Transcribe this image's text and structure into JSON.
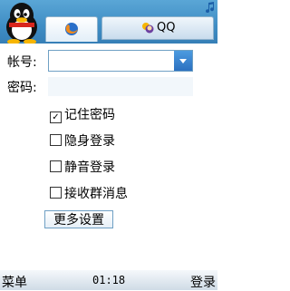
{
  "header": {
    "tab_left_icon": "firefox-like-globe-icon",
    "tab_right_label": "QQ",
    "tab_right_icon": "qq-buddy-icon",
    "status_icon": "music-note-icon"
  },
  "form": {
    "account_label": "帐号:",
    "password_label": "密码:",
    "account_value": "",
    "password_value": ""
  },
  "options": [
    {
      "label": "记住密码",
      "checked": true
    },
    {
      "label": "隐身登录",
      "checked": false
    },
    {
      "label": "静音登录",
      "checked": false
    },
    {
      "label": "接收群消息",
      "checked": false
    }
  ],
  "more_settings_label": "更多设置",
  "footer": {
    "left_soft_key": "菜单",
    "clock": "01:18",
    "right_soft_key": "登录"
  },
  "colors": {
    "header_blue": "#3f8dc4",
    "accent_blue": "#2b70c0",
    "field_border": "#6fa0c4"
  }
}
